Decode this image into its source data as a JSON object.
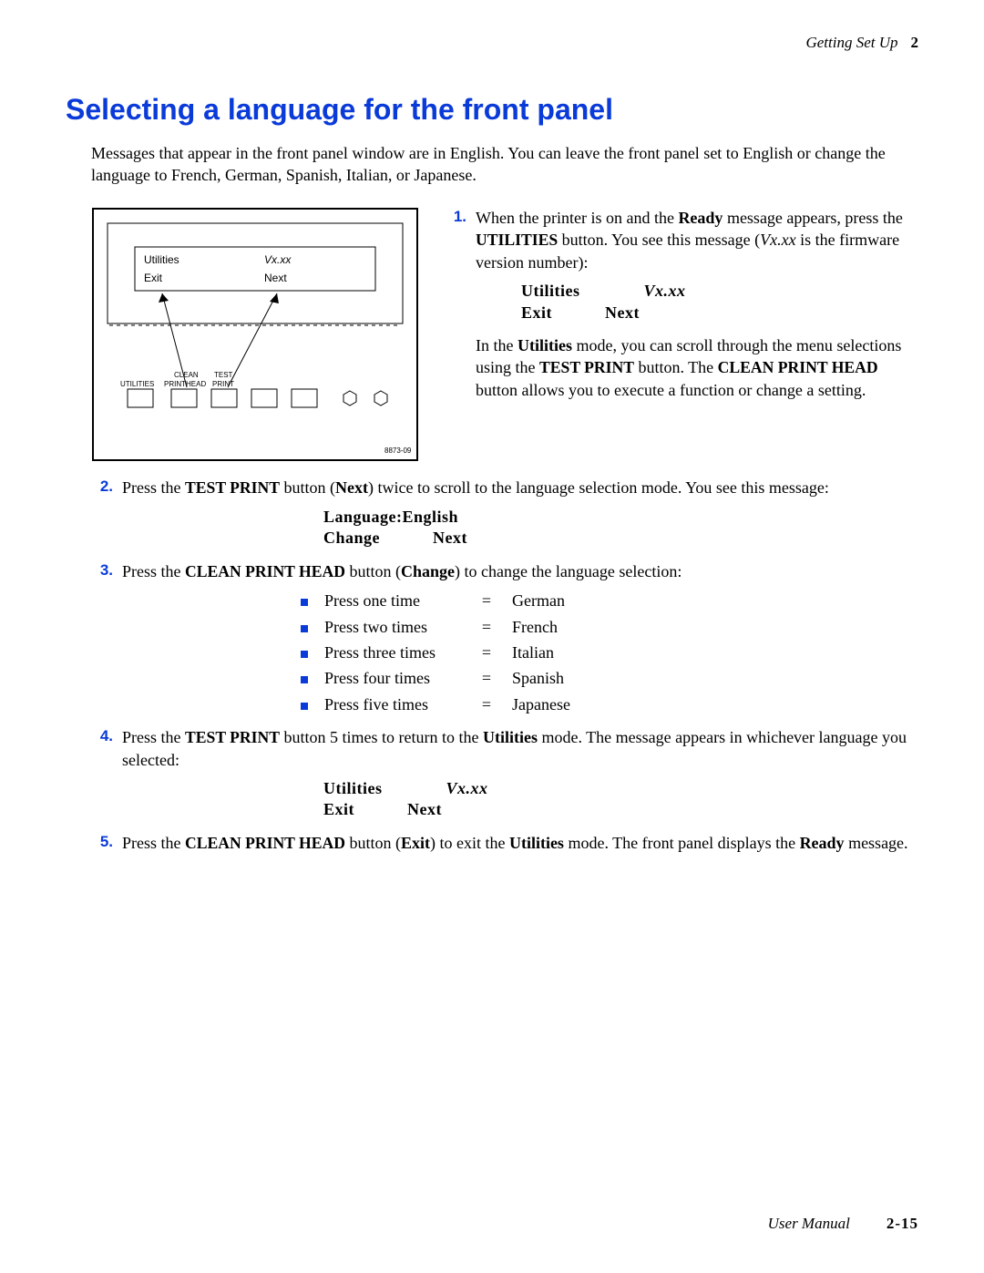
{
  "header": {
    "section": "Getting Set Up",
    "chapter": "2"
  },
  "title": "Selecting a language for the front panel",
  "intro": "Messages that appear in the front panel window are in English.  You can leave the front panel set to English or change the language to French, German, Spanish, Italian, or Japanese.",
  "diagram": {
    "lcd": {
      "row1a": "Utilities",
      "row1b": "Vx.xx",
      "row2a": "Exit",
      "row2b": "Next"
    },
    "labels": {
      "b1": "UTILITIES",
      "b2a": "CLEAN",
      "b2b": "PRINTHEAD",
      "b3a": "TEST",
      "b3b": "PRINT"
    },
    "code": "8873-09"
  },
  "step1": {
    "n": "1.",
    "t1": "When the printer is on and the ",
    "ready": "Ready",
    "t2": " message appears, press the ",
    "utilitiesBtn": "UTILITIES",
    "t3": " button.  You see this message (",
    "vxxx": "Vx.xx",
    "t4": " is the firmware version number):",
    "lcd": {
      "a": "Utilities",
      "b": "Vx.xx",
      "c": "Exit",
      "d": "Next"
    },
    "t5a": "In the ",
    "t5b": " mode, you can scroll through the menu selections using the ",
    "testprint": "TEST PRINT",
    "t5c": " button.  The ",
    "clean": "CLEAN PRINT HEAD",
    "t5d": " button allows you to execute a function or change a setting.",
    "utilities": "Utilities"
  },
  "step2": {
    "n": "2.",
    "t1": "Press the ",
    "testprint": "TEST PRINT",
    "t2a": " button (",
    "nextLabel": "Next",
    "t2b": ") twice to scroll to the language selection mode.  You see this message:",
    "lcd": {
      "a": "Language:English",
      "b": "Change",
      "c": "Next"
    }
  },
  "step3": {
    "n": "3.",
    "t1": "Press the ",
    "clean": "CLEAN PRINT HEAD",
    "t2a": " button (",
    "changeLabel": "Change",
    "t2b": ") to change the language selection:",
    "items": [
      {
        "left": "Press one time",
        "eq": "=",
        "right": "German"
      },
      {
        "left": "Press two times",
        "eq": "=",
        "right": "French"
      },
      {
        "left": "Press three times",
        "eq": "=",
        "right": "Italian"
      },
      {
        "left": "Press four times",
        "eq": "=",
        "right": "Spanish"
      },
      {
        "left": "Press five times",
        "eq": "=",
        "right": "Japanese"
      }
    ]
  },
  "step4": {
    "n": "4.",
    "t1": "Press the ",
    "testprint": "TEST PRINT",
    "t2": " button 5 times to return to the ",
    "utilities": "Utilities",
    "t3": " mode.  The message appears in whichever language you selected:",
    "lcd": {
      "a": "Utilities",
      "b": "Vx.xx",
      "c": "Exit",
      "d": "Next"
    }
  },
  "step5": {
    "n": "5.",
    "t1": "Press the ",
    "clean": "CLEAN PRINT HEAD",
    "t2a": " button (",
    "exitLabel": "Exit",
    "t2b": ") to exit the ",
    "utilities": "Utilities",
    "t3": " mode.  The front panel displays the ",
    "ready": "Ready",
    "t4": " message."
  },
  "footer": {
    "book": "User Manual",
    "page": "2-15"
  }
}
